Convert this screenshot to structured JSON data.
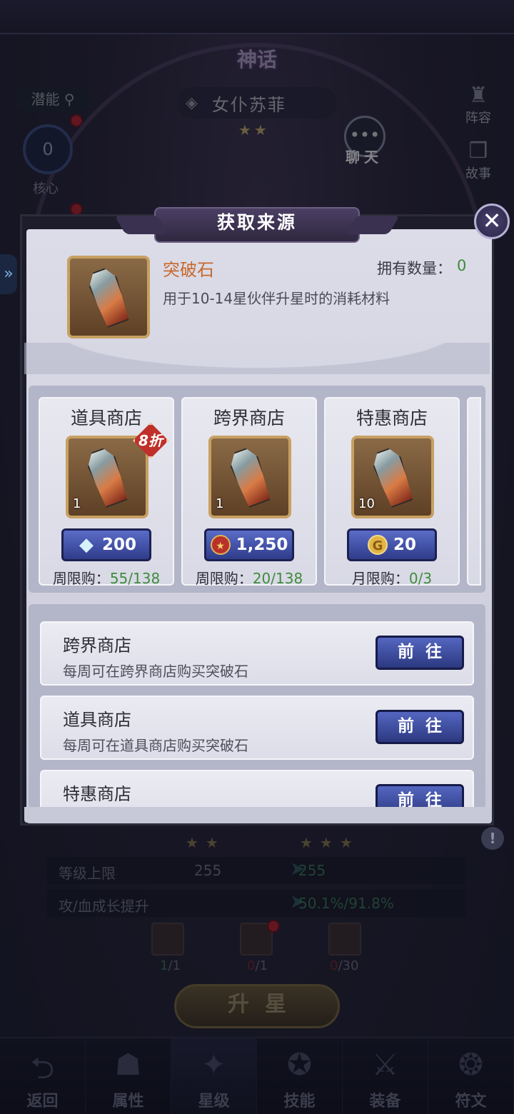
{
  "background": {
    "myth_badge": "神话",
    "hero_name": "女仆苏菲",
    "hero_stars": "★★",
    "potential_label": "潜能",
    "core_value": "0",
    "core_label": "核心",
    "side_buttons": [
      "阵容",
      "故事"
    ],
    "chat_label": "聊天",
    "compare": {
      "old_stars": "★★",
      "new_stars": "★★★",
      "rows": [
        {
          "label": "等级上限",
          "old": "255",
          "new": "255"
        },
        {
          "label": "攻/血成长提升",
          "old": "",
          "new": "50.1%/91.8%"
        }
      ]
    },
    "requirements": [
      {
        "cur": "1",
        "total": "/1"
      },
      {
        "cur": "0",
        "total": "/1"
      },
      {
        "cur": "0",
        "total": "/30"
      }
    ],
    "upstar_label": "升星",
    "bottom_nav": [
      {
        "label": "返回",
        "icon": "back-icon"
      },
      {
        "label": "属性",
        "icon": "attribute-icon"
      },
      {
        "label": "星级",
        "icon": "star-level-icon"
      },
      {
        "label": "技能",
        "icon": "skill-icon"
      },
      {
        "label": "装备",
        "icon": "equipment-icon"
      },
      {
        "label": "符文",
        "icon": "rune-icon"
      }
    ],
    "active_nav": "星级"
  },
  "dialog": {
    "title": "获取来源",
    "close_icon": "close-icon",
    "item": {
      "name": "突破石",
      "owned_label": "拥有数量：",
      "owned_value": "0",
      "description": "用于10-14星伙伴升星时的消耗材料",
      "icon": "breakthrough-stone-icon"
    },
    "shops": [
      {
        "title": "道具商店",
        "qty": "1",
        "discount": "8折",
        "price_icon": "diamond-icon",
        "price": "200",
        "limit_label": "周限购：",
        "limit_value": "55/138"
      },
      {
        "title": "跨界商店",
        "qty": "1",
        "discount": "",
        "price_icon": "medal-icon",
        "price": "1,250",
        "limit_label": "周限购：",
        "limit_value": "20/138"
      },
      {
        "title": "特惠商店",
        "qty": "10",
        "discount": "",
        "price_icon": "gold-coin-icon",
        "price": "20",
        "limit_label": "月限购：",
        "limit_value": "0/3"
      }
    ],
    "sources": [
      {
        "name": "跨界商店",
        "desc": "每周可在跨界商店购买突破石",
        "button": "前往"
      },
      {
        "name": "道具商店",
        "desc": "每周可在道具商店购买突破石",
        "button": "前往"
      },
      {
        "name": "特惠商店",
        "desc": "",
        "button": "前往"
      }
    ]
  },
  "colors": {
    "accent_blue": "#3d4ea8",
    "owned_green": "#3f8b3c",
    "item_name_orange": "#c8682c",
    "discount_red": "#c0302a"
  }
}
